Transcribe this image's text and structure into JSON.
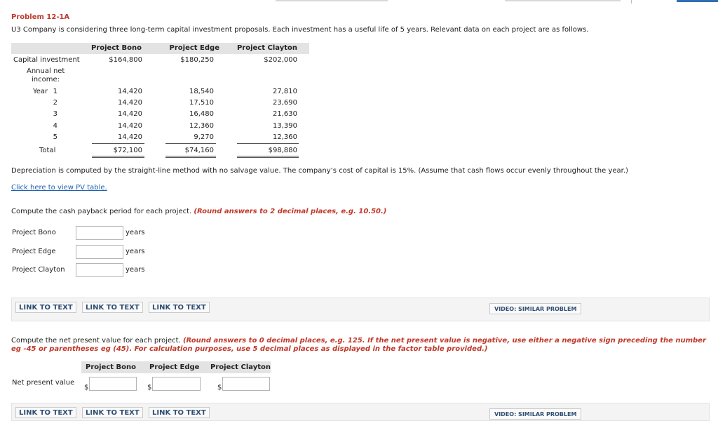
{
  "problem_title": "Problem 12-1A",
  "intro": "U3 Company is considering three long-term capital investment proposals. Each investment has a useful life of 5 years. Relevant data on each project are as follows.",
  "table": {
    "headers": [
      "Project Bono",
      "Project Edge",
      "Project Clayton"
    ],
    "capital_label": "Capital investment",
    "capital": [
      "$164,800",
      "$180,250",
      "$202,000"
    ],
    "annual_label_1": "Annual net",
    "annual_label_2": "income:",
    "year_label": "Year",
    "rows": [
      {
        "year": "1",
        "values": [
          "14,420",
          "18,540",
          "27,810"
        ]
      },
      {
        "year": "2",
        "values": [
          "14,420",
          "17,510",
          "23,690"
        ]
      },
      {
        "year": "3",
        "values": [
          "14,420",
          "16,480",
          "21,630"
        ]
      },
      {
        "year": "4",
        "values": [
          "14,420",
          "12,360",
          "13,390"
        ]
      },
      {
        "year": "5",
        "values": [
          "14,420",
          "9,270",
          "12,360"
        ]
      }
    ],
    "total_label": "Total",
    "totals": [
      "$72,100",
      "$74,160",
      "$98,880"
    ]
  },
  "depreciation_note": "Depreciation is computed by the straight-line method with no salvage value. The company’s cost of capital is 15%. (Assume that cash flows occur evenly throughout the year.)",
  "pv_link": "Click here to view PV table.",
  "payback": {
    "instruction": "Compute the cash payback period for each project.",
    "instruction_red": "(Round answers to 2 decimal places, e.g. 10.50.)",
    "unit": "years",
    "projects": [
      {
        "label": "Project Bono",
        "value": ""
      },
      {
        "label": "Project Edge",
        "value": ""
      },
      {
        "label": "Project Clayton",
        "value": ""
      }
    ]
  },
  "link_to_text": "LINK TO TEXT",
  "video_similar": "VIDEO: SIMILAR PROBLEM",
  "npv": {
    "instruction": "Compute the net present value for each project.",
    "red_line_1": "(Round answers to 0 decimal places, e.g. 125.  If the net present value is negative, use either a negative sign preceding the number",
    "red_line_2": "eg -45 or parentheses eg (45). For calculation purposes, use 5 decimal places as displayed in the factor table provided.)",
    "headers": [
      "Project Bono",
      "Project Edge",
      "Project Clayton"
    ],
    "row_label": "Net present value",
    "currency": "$",
    "values": [
      "",
      "",
      ""
    ]
  }
}
